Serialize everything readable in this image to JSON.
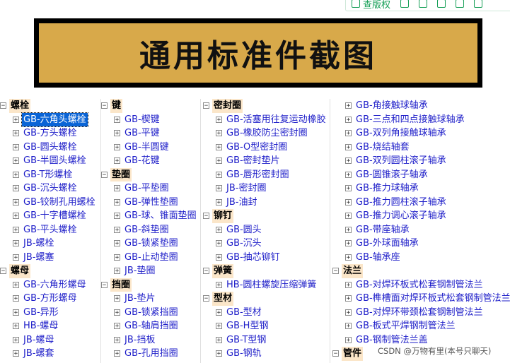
{
  "toolbar": {
    "items": [
      {
        "label": "查版权",
        "icon": "copyright-icon"
      },
      {
        "label": "",
        "icon": "copy-icon"
      },
      {
        "label": "",
        "icon": "crop-icon"
      },
      {
        "label": "",
        "icon": "save-icon"
      },
      {
        "label": "",
        "icon": "edit-icon"
      },
      {
        "label": "",
        "icon": "settings-icon"
      }
    ]
  },
  "banner": {
    "title": "通用标准件截图"
  },
  "tree": {
    "col1": [
      {
        "type": "cat",
        "label": "螺栓"
      },
      {
        "type": "item",
        "label": "GB-六角头螺栓",
        "selected": true
      },
      {
        "type": "item",
        "label": "GB-方头螺栓"
      },
      {
        "type": "item",
        "label": "GB-圆头螺栓"
      },
      {
        "type": "item",
        "label": "GB-半圆头螺栓"
      },
      {
        "type": "item",
        "label": "GB-T形螺栓"
      },
      {
        "type": "item",
        "label": "GB-沉头螺栓"
      },
      {
        "type": "item",
        "label": "GB-铰制孔用螺栓"
      },
      {
        "type": "item",
        "label": "GB-十字槽螺栓"
      },
      {
        "type": "item",
        "label": "GB-平头螺栓"
      },
      {
        "type": "item",
        "label": "JB-螺栓"
      },
      {
        "type": "item",
        "label": "JB-螺塞"
      },
      {
        "type": "cat",
        "label": "螺母"
      },
      {
        "type": "item",
        "label": "GB-六角形螺母"
      },
      {
        "type": "item",
        "label": "GB-方形螺母"
      },
      {
        "type": "item",
        "label": "GB-异形"
      },
      {
        "type": "item",
        "label": "HB-螺母"
      },
      {
        "type": "item",
        "label": "JB-螺母"
      },
      {
        "type": "item",
        "label": "JB-螺套"
      }
    ],
    "col2": [
      {
        "type": "cat",
        "label": "键"
      },
      {
        "type": "item",
        "label": "GB-楔键"
      },
      {
        "type": "item",
        "label": "GB-平键"
      },
      {
        "type": "item",
        "label": "GB-半圆键"
      },
      {
        "type": "item",
        "label": "GB-花键"
      },
      {
        "type": "cat",
        "label": "垫圈"
      },
      {
        "type": "item",
        "label": "GB-平垫圈"
      },
      {
        "type": "item",
        "label": "GB-弹性垫圈"
      },
      {
        "type": "item",
        "label": "GB-球、锥面垫圈"
      },
      {
        "type": "item",
        "label": "GB-斜垫圈"
      },
      {
        "type": "item",
        "label": "GB-锁紧垫圈"
      },
      {
        "type": "item",
        "label": "GB-止动垫圈"
      },
      {
        "type": "item",
        "label": "JB-垫圈"
      },
      {
        "type": "cat",
        "label": "挡圈"
      },
      {
        "type": "item",
        "label": "JB-垫片"
      },
      {
        "type": "item",
        "label": "GB-锁紧挡圈"
      },
      {
        "type": "item",
        "label": "GB-轴肩挡圈"
      },
      {
        "type": "item",
        "label": "JB-挡板"
      },
      {
        "type": "item",
        "label": "GB-孔用挡圈"
      }
    ],
    "col3": [
      {
        "type": "cat",
        "label": "密封圈"
      },
      {
        "type": "item",
        "label": "GB-活塞用往复运动橡胶"
      },
      {
        "type": "item",
        "label": "GB-橡胶防尘密封圈"
      },
      {
        "type": "item",
        "label": "GB-O型密封圈"
      },
      {
        "type": "item",
        "label": "GB-密封垫片"
      },
      {
        "type": "item",
        "label": "GB-唇形密封圈"
      },
      {
        "type": "item",
        "label": "JB-密封圈"
      },
      {
        "type": "item",
        "label": "JB-油封"
      },
      {
        "type": "cat",
        "label": "铆钉"
      },
      {
        "type": "item",
        "label": "GB-圆头"
      },
      {
        "type": "item",
        "label": "GB-沉头"
      },
      {
        "type": "item",
        "label": "GB-抽芯铆钉"
      },
      {
        "type": "cat",
        "label": "弹簧"
      },
      {
        "type": "item",
        "label": "HB-圆柱螺旋压缩弹簧"
      },
      {
        "type": "cat",
        "label": "型材"
      },
      {
        "type": "item",
        "label": "GB-型材"
      },
      {
        "type": "item",
        "label": "GB-H型钢"
      },
      {
        "type": "item",
        "label": "GB-T型钢"
      },
      {
        "type": "item",
        "label": "GB-钢轨"
      }
    ],
    "col4": [
      {
        "type": "item",
        "label": "GB-角接触球轴承"
      },
      {
        "type": "item",
        "label": "GB-三点和四点接触球轴承"
      },
      {
        "type": "item",
        "label": "GB-双列角接触球轴承"
      },
      {
        "type": "item",
        "label": "GB-烧结轴套"
      },
      {
        "type": "item",
        "label": "GB-双列圆柱滚子轴承"
      },
      {
        "type": "item",
        "label": "GB-圆锥滚子轴承"
      },
      {
        "type": "item",
        "label": "GB-推力球轴承"
      },
      {
        "type": "item",
        "label": "GB-推力圆柱滚子轴承"
      },
      {
        "type": "item",
        "label": "GB-推力调心滚子轴承"
      },
      {
        "type": "item",
        "label": "GB-带座轴承"
      },
      {
        "type": "item",
        "label": "GB-外球面轴承"
      },
      {
        "type": "item",
        "label": "GB-轴承座"
      },
      {
        "type": "cat",
        "label": "法兰"
      },
      {
        "type": "item",
        "label": "GB-对焊环板式松套钢制管法兰"
      },
      {
        "type": "item",
        "label": "GB-榫槽面对焊环板式松套钢制管法兰"
      },
      {
        "type": "item",
        "label": "GB-对焊环带颈松套钢制管法兰"
      },
      {
        "type": "item",
        "label": "GB-板式平焊钢制管法兰"
      },
      {
        "type": "item",
        "label": "GB-钢制管法兰盖"
      },
      {
        "type": "cat",
        "label": "管件"
      }
    ]
  },
  "watermark": "CSDN @万物有里(本号只聊天)"
}
